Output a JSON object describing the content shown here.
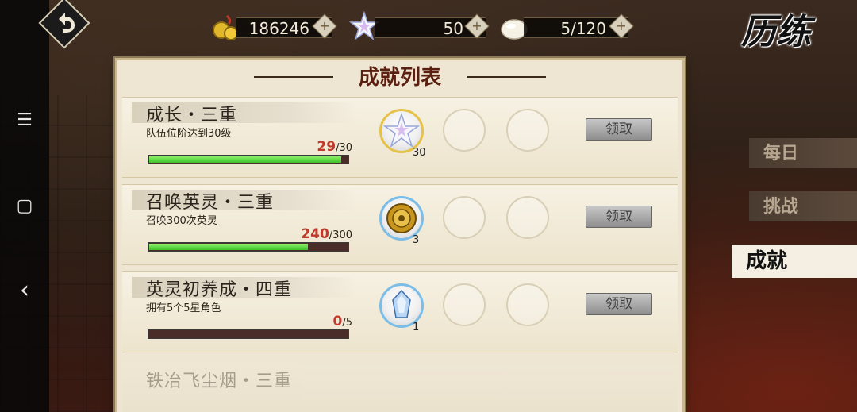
{
  "header": {
    "title": "历练",
    "resources": [
      {
        "icon": "gold-coin-icon",
        "value": "186246"
      },
      {
        "icon": "star-crystal-icon",
        "value": "50"
      },
      {
        "icon": "steamed-bun-icon",
        "value": "5/120"
      }
    ],
    "add_icon": "+"
  },
  "panel": {
    "title": "成就列表",
    "claim_label": "领取",
    "achievements": [
      {
        "title": "成长・三重",
        "desc": "队伍位阶达到30级",
        "current": "29",
        "total": "/30",
        "progress": 0.967,
        "reward_icon": "star-crystal-icon",
        "reward_count": "30"
      },
      {
        "title": "召唤英灵・三重",
        "desc": "召唤300次英灵",
        "current": "240",
        "total": "/300",
        "progress": 0.8,
        "reward_icon": "summon-compass-icon",
        "reward_count": "3"
      },
      {
        "title": "英灵初养成・四重",
        "desc": "拥有5个5星角色",
        "current": "0",
        "total": "/5",
        "progress": 0.0,
        "reward_icon": "blue-crystal-icon",
        "reward_count": "1"
      }
    ],
    "partial_title": "铁冶飞尘烟・三重"
  },
  "side_tabs": [
    {
      "label": "每日",
      "active": false
    },
    {
      "label": "挑战",
      "active": false
    },
    {
      "label": "成就",
      "active": true
    }
  ],
  "system_nav": {
    "menu": "☰",
    "home": "▢",
    "back": "‹"
  },
  "colors": {
    "progress": "#3fc12a",
    "accent": "#5a1f10",
    "current_value": "#c0392b"
  }
}
